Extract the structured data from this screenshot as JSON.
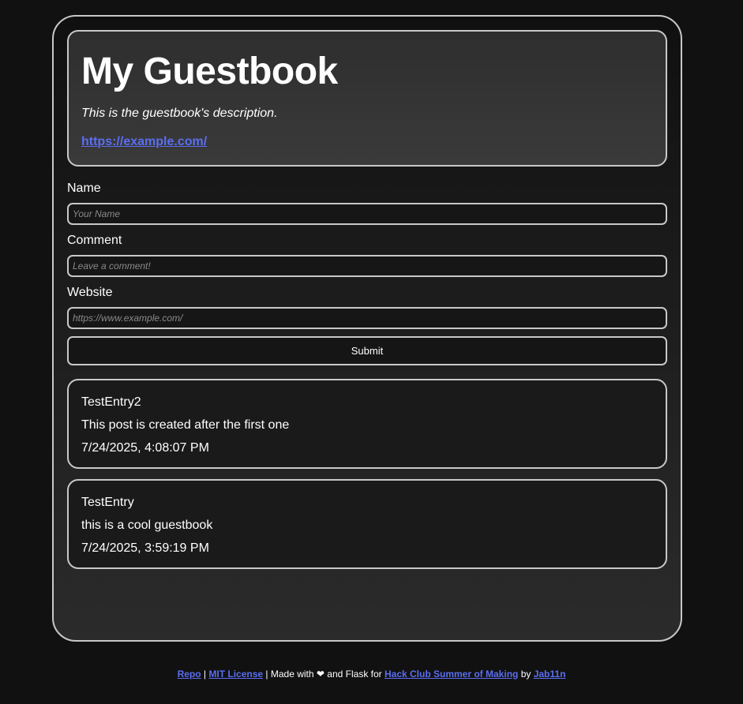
{
  "header": {
    "title": "My Guestbook",
    "description": "This is the guestbook's description.",
    "link": "https://example.com/"
  },
  "form": {
    "name_label": "Name",
    "name_placeholder": "Your Name",
    "comment_label": "Comment",
    "comment_placeholder": "Leave a comment!",
    "website_label": "Website",
    "website_placeholder": "https://www.example.com/",
    "submit_label": "Submit"
  },
  "entries": [
    {
      "name": "TestEntry2",
      "comment": "This post is created after the first one",
      "timestamp": "7/24/2025, 4:08:07 PM"
    },
    {
      "name": "TestEntry",
      "comment": "this is a cool guestbook",
      "timestamp": "7/24/2025, 3:59:19 PM"
    }
  ],
  "footer": {
    "repo": "Repo",
    "sep1": " | ",
    "license": "MIT License",
    "made_with": " | Made with ",
    "heart": "❤",
    "and_flask": " and Flask for ",
    "event": "Hack Club Summer of Making",
    "by": " by ",
    "author": "Jab11n"
  },
  "colors": {
    "link": "#5b6ef0",
    "border": "#c8c8c8",
    "background": "#111111"
  }
}
